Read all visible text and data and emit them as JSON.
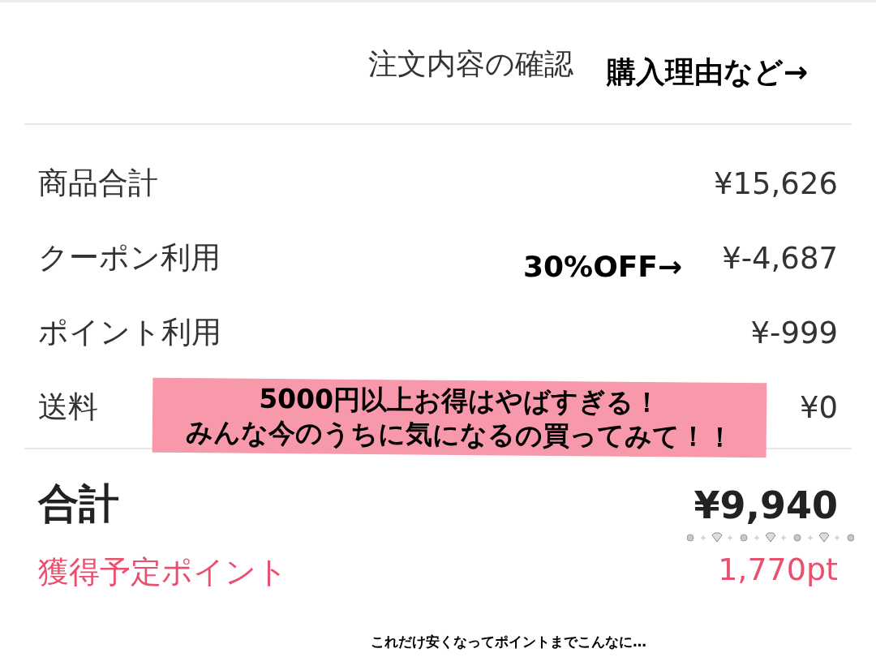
{
  "header": {
    "title": "注文内容の確認"
  },
  "summary": {
    "rows": [
      {
        "label": "商品合計",
        "value": "¥15,626"
      },
      {
        "label": "クーポン利用",
        "value": "¥-4,687"
      },
      {
        "label": "ポイント利用",
        "value": "¥-999"
      },
      {
        "label": "送料",
        "value": "¥0"
      }
    ]
  },
  "total": {
    "label": "合計",
    "value": "¥9,940"
  },
  "points": {
    "label": "獲得予定ポイント",
    "value": "1,770pt"
  },
  "annotations": [
    {
      "kind": "caption",
      "lines": [
        "購入理由など→"
      ]
    },
    {
      "kind": "caption",
      "lines": [
        "30%OFF→"
      ]
    },
    {
      "kind": "banner",
      "lines": [
        "5000円以上お得はやばすぎる！",
        "みんな今のうちに気になるの買ってみて！！"
      ]
    },
    {
      "kind": "small",
      "lines": [
        "これだけ安くなってポイントまでこんなに…"
      ]
    }
  ]
}
